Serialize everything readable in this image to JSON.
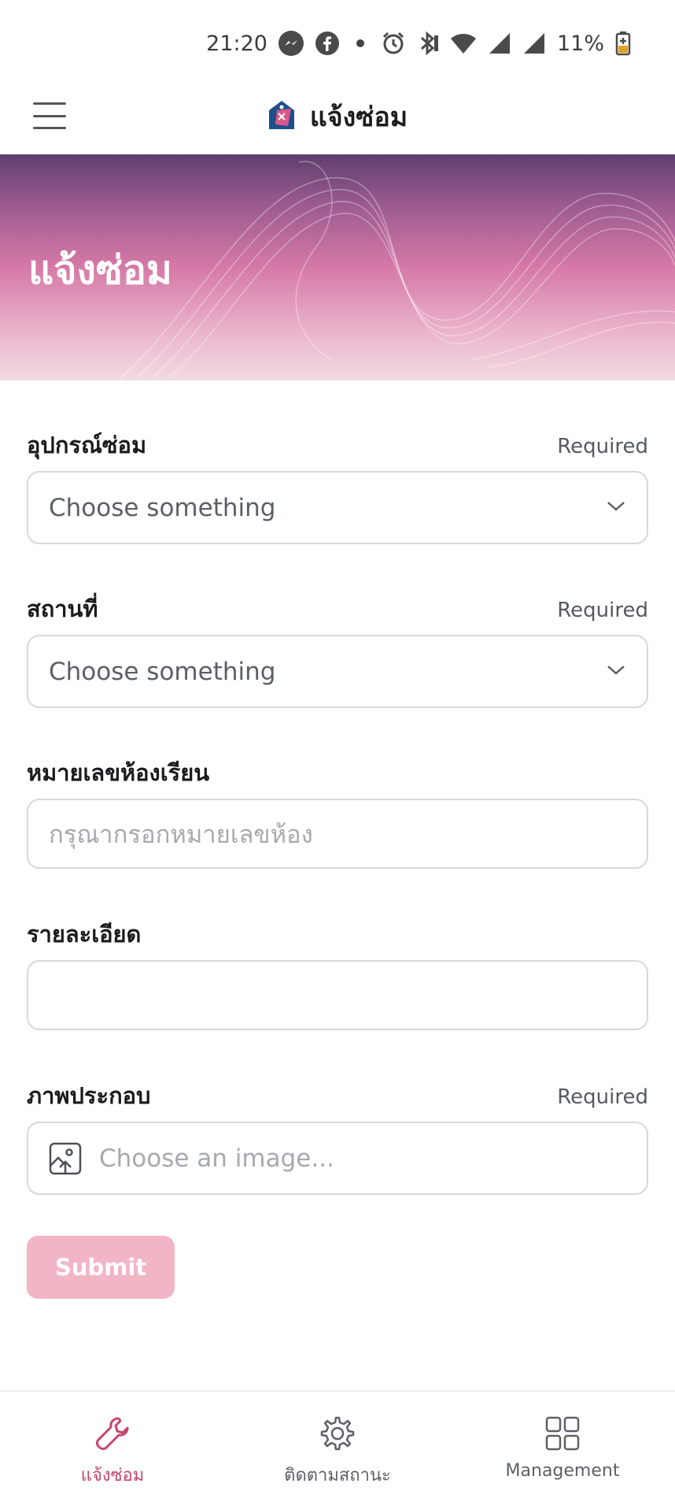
{
  "status_bar": {
    "time": "21:20",
    "battery_text": "11%",
    "icons": [
      "messenger-icon",
      "facebook-icon",
      "notification-dot-icon",
      "alarm-icon",
      "bluetooth-icon",
      "wifi-icon",
      "signal-icon",
      "signal-icon",
      "battery-icon"
    ]
  },
  "header": {
    "title": "แจ้งซ่อม",
    "menu_icon": "hamburger-menu-icon",
    "logo_icon": "app-logo-icon"
  },
  "hero": {
    "title": "แจ้งซ่อม"
  },
  "form": {
    "equipment": {
      "label": "อุปกรณ์ซ่อม",
      "required": "Required",
      "value": "Choose something"
    },
    "location": {
      "label": "สถานที่",
      "required": "Required",
      "value": "Choose something"
    },
    "room": {
      "label": "หมายเลขห้องเรียน",
      "placeholder": "กรุณากรอกหมายเลขห้อง"
    },
    "details": {
      "label": "รายละเอียด",
      "value": ""
    },
    "image": {
      "label": "ภาพประกอบ",
      "required": "Required",
      "placeholder": "Choose an image..."
    },
    "submit_label": "Submit"
  },
  "colors": {
    "accent": "#c8456b",
    "submit_disabled": "#f2b5c5",
    "border": "#d6d8dd"
  },
  "bottom_nav": {
    "items": [
      {
        "label": "แจ้งซ่อม",
        "icon": "wrench-icon",
        "active": true
      },
      {
        "label": "ติดตามสถานะ",
        "icon": "gear-icon",
        "active": false
      },
      {
        "label": "Management",
        "icon": "grid-icon",
        "active": false
      }
    ]
  }
}
